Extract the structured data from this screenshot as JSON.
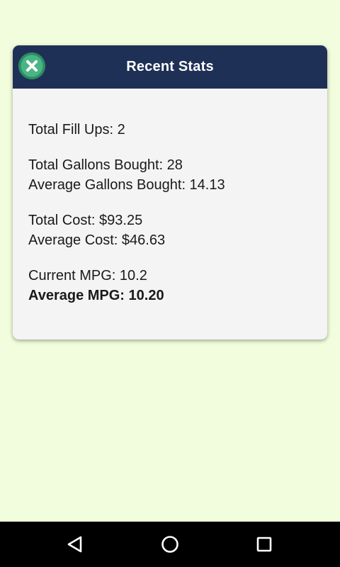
{
  "dialog": {
    "title": "Recent Stats",
    "close_icon": "close-icon"
  },
  "stats": {
    "total_fill_ups": "Total Fill Ups: 2",
    "total_gallons": "Total Gallons Bought: 28",
    "average_gallons": "Average Gallons Bought: 14.13",
    "total_cost": "Total Cost: $93.25",
    "average_cost": "Average Cost: $46.63",
    "current_mpg": "Current MPG: 10.2",
    "average_mpg": "Average MPG: 10.20"
  },
  "nav": {
    "back_icon": "back-triangle-icon",
    "home_icon": "home-circle-icon",
    "recents_icon": "recents-square-icon"
  },
  "colors": {
    "background": "#f1fddc",
    "header": "#1f3056",
    "close_button": "#3aa377",
    "dialog_body": "#f4f4f4"
  }
}
